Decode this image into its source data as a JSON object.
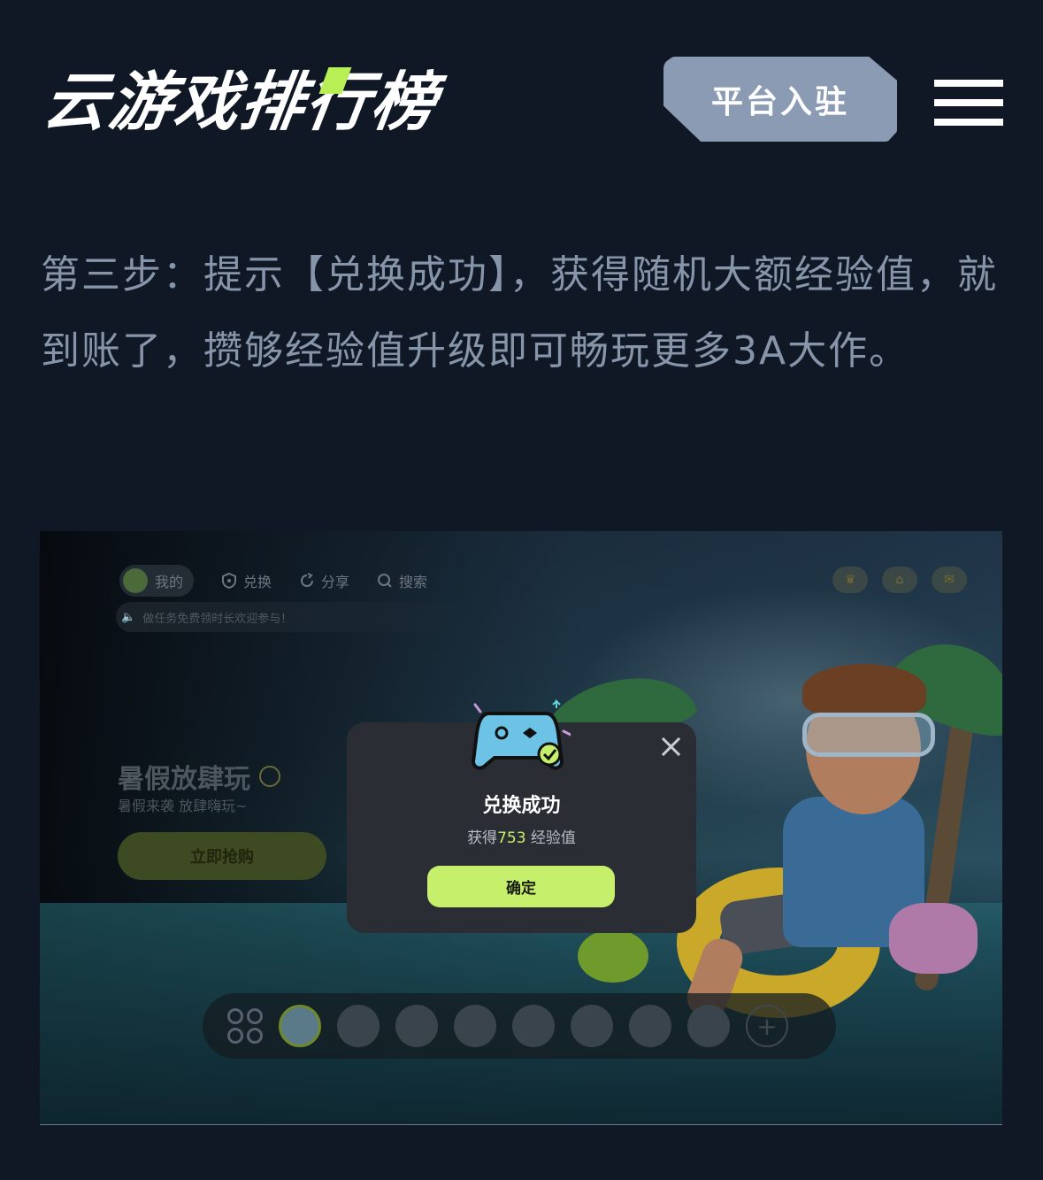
{
  "header": {
    "logo_text": "云游戏排行榜",
    "platform_button": "平台入驻",
    "menu_icon": "hamburger-menu-icon"
  },
  "article": {
    "paragraph": "第三步：提示【兑换成功】，获得随机大额经验值，就到账了，攒够经验值升级即可畅玩更多3A大作。"
  },
  "screenshot": {
    "nav": {
      "mine": "我的",
      "exchange": "兑换",
      "share": "分享",
      "search": "搜索"
    },
    "notice": "做任务免费领时长欢迎参与！",
    "promo": {
      "title": "暑假放肆玩",
      "subtitle": "暑假来袭 放肆嗨玩~",
      "buy_button": "立即抢购"
    },
    "dialog": {
      "title": "兑换成功",
      "reward_prefix": "获得",
      "reward_amount": "753",
      "reward_suffix": " 经验值",
      "confirm_button": "确定"
    },
    "accent_color": "#c6f06c"
  }
}
